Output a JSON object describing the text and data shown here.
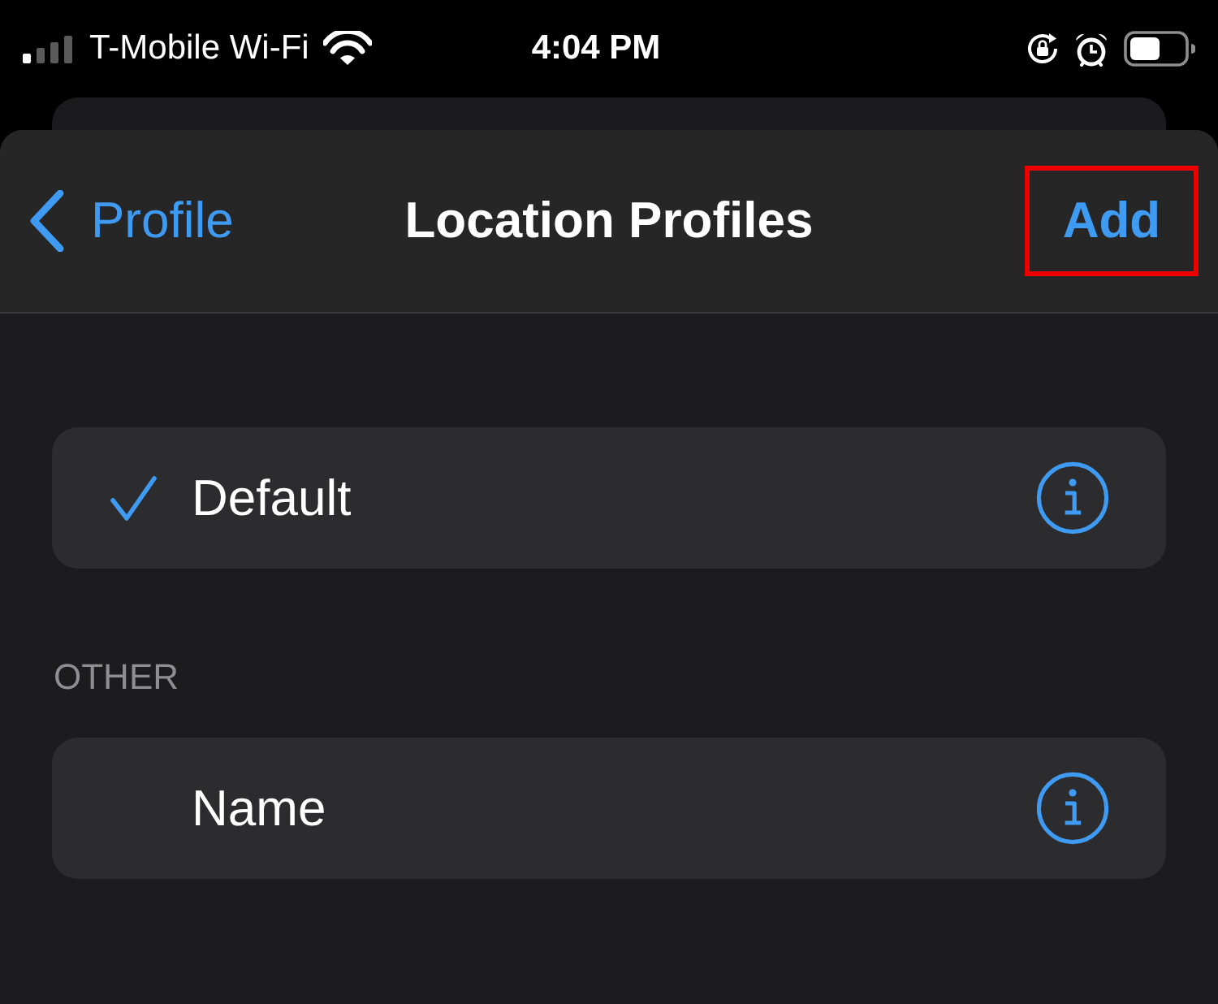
{
  "status_bar": {
    "carrier": "T-Mobile Wi-Fi",
    "time": "4:04 PM"
  },
  "nav_bar": {
    "back_label": "Profile",
    "title": "Location Profiles",
    "action": {
      "label": "Add",
      "highlighted": true
    }
  },
  "sections": [
    {
      "rows": [
        {
          "label": "Default",
          "checked": true
        }
      ]
    },
    {
      "header": "OTHER",
      "rows": [
        {
          "label": "Name",
          "checked": false
        }
      ]
    }
  ]
}
